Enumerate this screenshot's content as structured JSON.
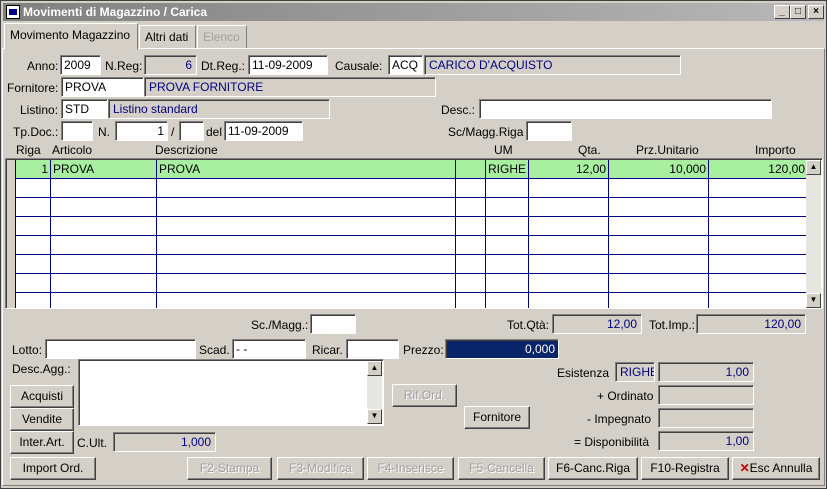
{
  "window": {
    "title": "Movimenti di Magazzino / Carica",
    "min": "_",
    "max": "□",
    "close": "×"
  },
  "tabs": [
    {
      "label": "Movimento Magazzino"
    },
    {
      "label": "Altri dati"
    },
    {
      "label": "Elenco"
    }
  ],
  "header": {
    "anno_label": "Anno:",
    "anno": "2009",
    "nreg_label": "N.Reg:",
    "nreg": "6",
    "dtreg_label": "Dt.Reg.:",
    "dtreg": "11-09-2009",
    "causale_label": "Causale:",
    "causale_code": "ACQ",
    "causale_desc": "CARICO D'ACQUISTO",
    "fornitore_label": "Fornitore:",
    "fornitore_code": "PROVA",
    "fornitore_desc": "PROVA FORNITORE",
    "listino_label": "Listino:",
    "listino_code": "STD",
    "listino_desc": "Listino standard",
    "desc_label": "Desc.:",
    "desc": "",
    "tpdoc_label": "Tp.Doc.:",
    "tpdoc": "",
    "n_label": "N.",
    "n": "1",
    "slash": "/",
    "n_suffix": "",
    "del_label": "del",
    "del": "11-09-2009",
    "scmagg_riga_label": "Sc/Magg.Riga",
    "scmagg_riga": ""
  },
  "grid": {
    "columns": [
      "Riga",
      "Articolo",
      "Descrizione",
      "UM",
      "Qta.",
      "Prz.Unitario",
      "Importo"
    ],
    "rows": [
      {
        "riga": "1",
        "articolo": "PROVA",
        "descrizione": "PROVA",
        "extra": "",
        "um": "RIGHE",
        "qta": "12,00",
        "prezzo": "10,000",
        "importo": "120,00"
      }
    ]
  },
  "totals": {
    "scmagg_label": "Sc./Magg.:",
    "scmagg": "",
    "totqta_label": "Tot.Qtà:",
    "totqta": "12,00",
    "totimp_label": "Tot.Imp.:",
    "totimp": "120,00"
  },
  "detail": {
    "lotto_label": "Lotto:",
    "lotto": "",
    "scad_label": "Scad.",
    "scad": "- -",
    "ricar_label": "Ricar.",
    "ricar": "",
    "prezzo_label": "Prezzo:",
    "prezzo": "0,000",
    "descagg_label": "Desc.Agg.:",
    "descagg": "",
    "cult_label": "C.Ult.",
    "cult": "1,000"
  },
  "stock": {
    "esistenza_label": "Esistenza",
    "esistenza_um": "RIGHE",
    "esistenza": "1,00",
    "ordinato_label": "+ Ordinato",
    "ordinato": "",
    "impegnato_label": "- Impegnato",
    "impegnato": "",
    "disponibilita_label": "= Disponibilità",
    "disponibilita": "1,00"
  },
  "buttons": {
    "acquisti": "Acquisti",
    "vendite": "Vendite",
    "interart": "Inter.Art.",
    "riford": "Rif.Ord.",
    "fornitore": "Fornitore",
    "import_ord": "Import Ord.",
    "f2": "F2-Stampa",
    "f3": "F3-Modifica",
    "f4": "F4-Inserisce",
    "f5": "F5-Cancella",
    "f6": "F6-Canc.Riga",
    "f10": "F10-Registra",
    "esc": "Esc Annulla"
  },
  "colors": {
    "selected_row": "#a8f0a0",
    "highlight_field": "#0a246a",
    "titlebar": "#808080"
  }
}
